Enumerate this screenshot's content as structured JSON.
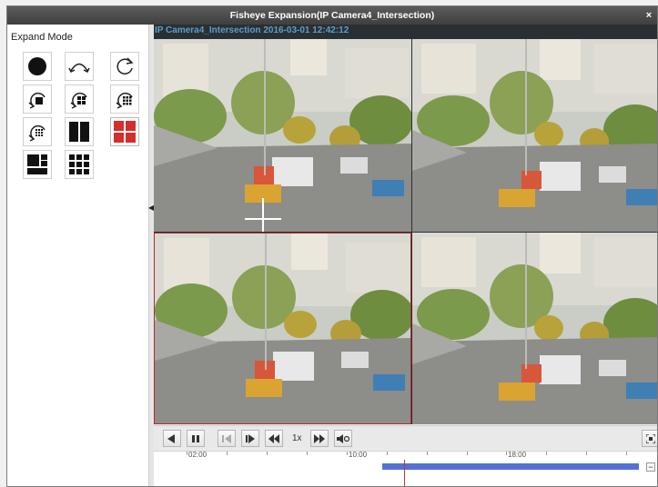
{
  "window": {
    "title": "Fisheye Expansion(IP Camera4_Intersection)",
    "close_glyph": "×"
  },
  "left_panel": {
    "label": "Expand Mode",
    "modes": [
      {
        "icon": "circle-icon",
        "active": false
      },
      {
        "icon": "arc-arrows-icon",
        "active": false
      },
      {
        "icon": "rotate-clockwise-icon",
        "active": false
      },
      {
        "icon": "rotate-single-view-icon",
        "active": false
      },
      {
        "icon": "rotate-4-view-icon",
        "active": false
      },
      {
        "icon": "rotate-9-view-icon",
        "active": false
      },
      {
        "icon": "rotate-grid-view-icon",
        "active": false
      },
      {
        "icon": "two-panel-icon",
        "active": false
      },
      {
        "icon": "four-panel-icon",
        "active": true
      },
      {
        "icon": "one-plus-three-icon",
        "active": false
      },
      {
        "icon": "one-plus-eight-icon",
        "active": false
      }
    ]
  },
  "video": {
    "overlay": "IP Camera4_Intersection   2016-03-01 12:42:12",
    "selected_cell": 2
  },
  "controls": {
    "speed": "1x",
    "buttons": [
      "stop",
      "pause",
      "slow-backward",
      "slow-forward",
      "rewind",
      "fast-forward",
      "capture",
      "fullscreen"
    ]
  },
  "timeline": {
    "labels": [
      "02:00",
      "10:00",
      "18:00"
    ],
    "zoom_out": "−",
    "zoom_in": "+"
  },
  "colors": {
    "accent": "#d32f2f",
    "timeline_bar": "#5470d6",
    "cursor": "#c0392b",
    "overlay_text": "#5a9ec9"
  }
}
